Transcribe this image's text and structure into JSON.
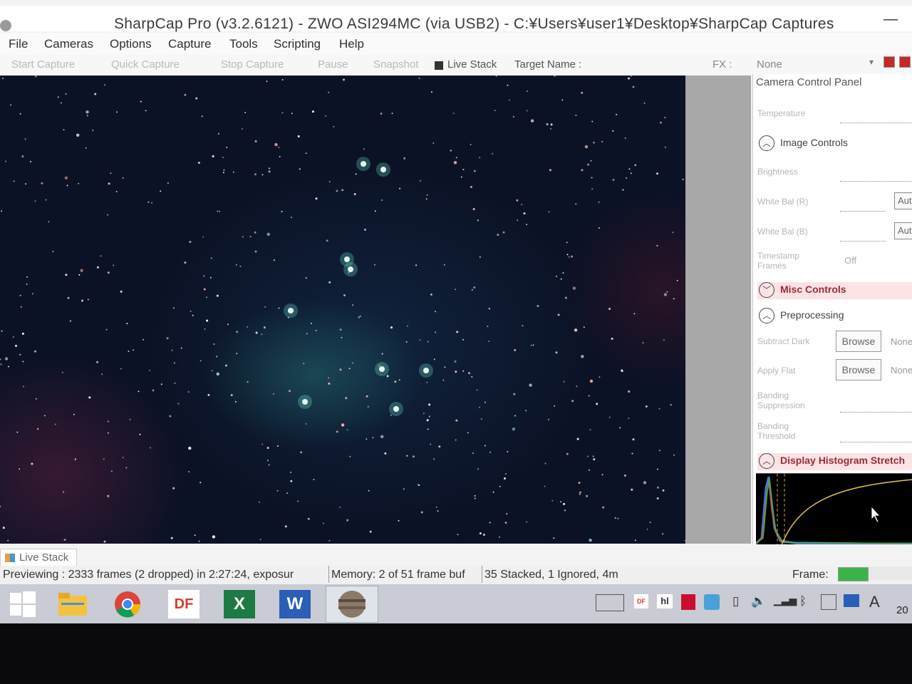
{
  "window": {
    "title": "SharpCap Pro (v3.2.6121) - ZWO ASI294MC (via USB2) - C:¥Users¥user1¥Desktop¥SharpCap Captures",
    "minimize_symbol": "—"
  },
  "menu": [
    "File",
    "Cameras",
    "Options",
    "Capture",
    "Tools",
    "Scripting",
    "Help"
  ],
  "toolbar": {
    "start_capture": "Start Capture",
    "quick_capture": "Quick Capture",
    "stop_capture": "Stop Capture",
    "pause": "Pause",
    "snapshot": "Snapshot",
    "live_stack": "Live Stack",
    "target_name": "Target Name :",
    "fx_label": "FX :",
    "fx_value": "None"
  },
  "panel": {
    "title": "Camera Control Panel",
    "temperature_label": "Temperature",
    "image_controls": "Image Controls",
    "brightness_label": "Brightness",
    "white_bal_r_label": "White Bal (R)",
    "white_bal_b_label": "White Bal (B)",
    "auto_label": "Auto",
    "timestamp_label": "Timestamp Frames",
    "timestamp_value": "Off",
    "misc_controls": "Misc Controls",
    "preprocessing": "Preprocessing",
    "subtract_dark_label": "Subtract Dark",
    "apply_flat_label": "Apply Flat",
    "browse_label": "Browse",
    "none_value": "None",
    "banding_suppression_label": "Banding Suppression",
    "banding_threshold_label": "Banding Threshold",
    "display_histogram": "Display Histogram Stretch"
  },
  "bottom_tab": {
    "label": "Live Stack"
  },
  "status": {
    "previewing": "Previewing : 2333 frames (2 dropped) in 2:27:24, exposur",
    "memory": "Memory: 2 of 51 frame buf",
    "stacked": "35 Stacked, 1 Ignored, 4m",
    "frame_label": "Frame:"
  },
  "frame_progress": 0.4,
  "taskbar": {
    "apps": [
      "windows-start",
      "file-explorer",
      "chrome",
      "df",
      "excel",
      "word",
      "sharpcap"
    ],
    "df_label": "DF",
    "word_label": "W",
    "excel_label": "X",
    "ime_label": "A",
    "clock": "20"
  },
  "colors": {
    "accent_pink": "#fbe3e6",
    "frame_green": "#3bb34a",
    "sky": "#0b1226"
  }
}
